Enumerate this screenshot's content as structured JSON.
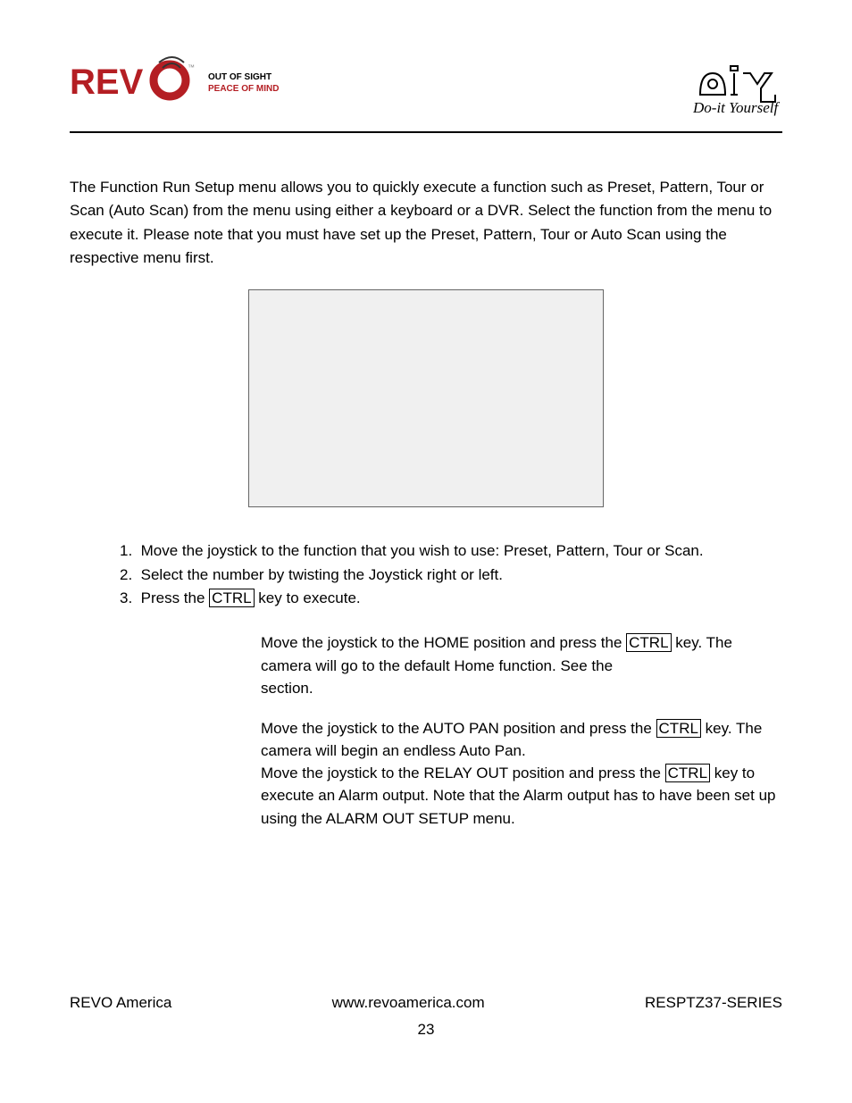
{
  "header": {
    "logo_text": "REVO",
    "logo_tm": "™",
    "tagline_line1": "OUT OF SIGHT",
    "tagline_line2": "PEACE OF MIND",
    "diy_main": "diy",
    "diy_sub": "Do-it Yourself"
  },
  "content": {
    "intro": "The Function Run Setup menu allows you to quickly execute a function such as Preset, Pattern, Tour or Scan (Auto Scan) from the menu using either a keyboard or a DVR. Select the function from the menu to execute it. Please note that you must have set up the Preset, Pattern, Tour or Auto Scan using the respective menu first.",
    "steps": [
      "Move the joystick to the function that you wish to use: Preset, Pattern, Tour or Scan.",
      "Select the number by twisting the Joystick right or left.",
      "Press the CTRL key to execute."
    ],
    "block1_pre": "Move the joystick to the HOME position and press the ",
    "block1_key": "CTRL",
    "block1_post": " key. The camera will go to the default Home function. See the ",
    "block1_end": "section.",
    "block2_pre": "Move the joystick to the AUTO PAN position and press the ",
    "block2_key": "CTRL",
    "block2_post": " key. The camera will begin an endless Auto Pan.",
    "block3_pre": "Move the joystick to the RELAY OUT position and press the ",
    "block3_key": "CTRL",
    "block3_post": " key to execute an Alarm output. Note that the Alarm output has to have been set up using the ALARM OUT SETUP menu.",
    "ctrl_key": "CTRL"
  },
  "footer": {
    "left": "REVO America",
    "center": "www.revoamerica.com",
    "right": "RESPTZ37-SERIES",
    "page_num": "23"
  }
}
